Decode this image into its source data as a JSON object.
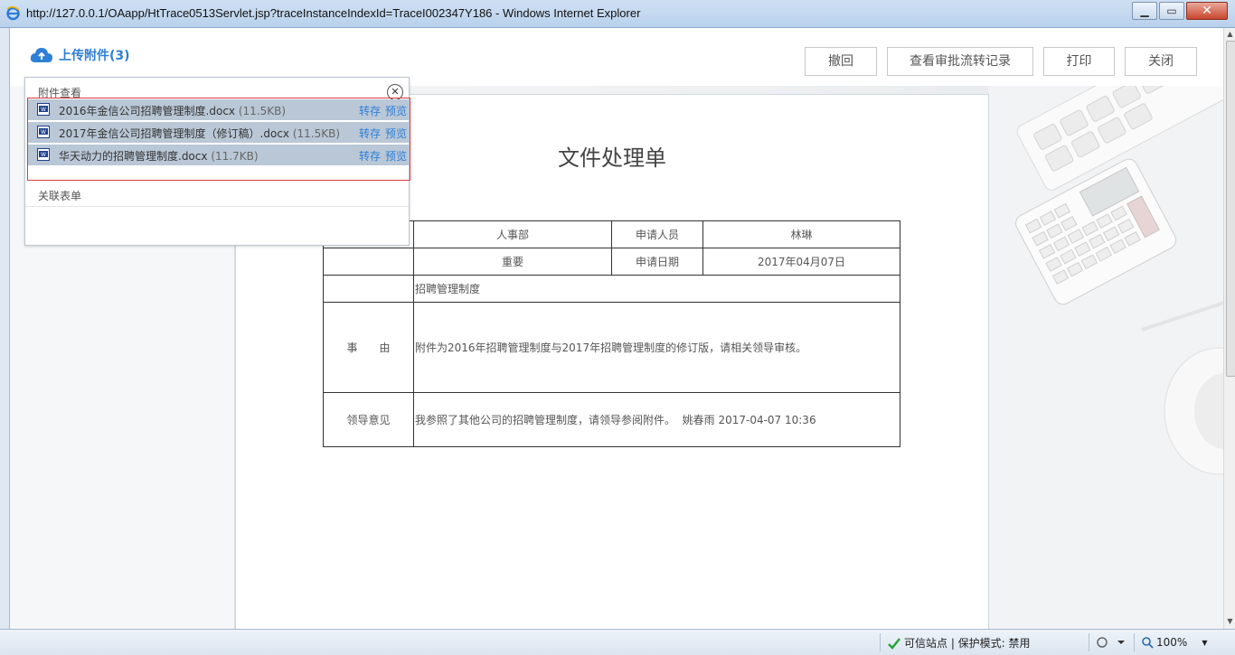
{
  "window": {
    "title": "http://127.0.0.1/OAapp/HtTrace0513Servlet.jsp?traceInstanceIndexId=TraceI002347Y186 - Windows Internet Explorer",
    "minimize_icon": "minimize-icon",
    "maximize_icon": "maximize-icon",
    "close_icon": "close-icon"
  },
  "toolbar": {
    "upload_label": "上传附件(3)",
    "buttons": [
      "撤回",
      "查看审批流转记录",
      "打印",
      "关闭"
    ]
  },
  "attachments_popup": {
    "header": "附件查看",
    "items": [
      {
        "name": "2016年金信公司招聘管理制度.docx",
        "size": "(11.5KB)",
        "save": "转存",
        "preview": "预览"
      },
      {
        "name": "2017年金信公司招聘管理制度（修订稿）.docx",
        "size": "(11.5KB)",
        "save": "转存",
        "preview": "预览"
      },
      {
        "name": "华天动力的招聘管理制度.docx",
        "size": "(11.7KB)",
        "save": "转存",
        "preview": "预览"
      }
    ],
    "related_forms": "关联表单"
  },
  "document": {
    "title": "文件处理单",
    "department": "人事部",
    "applicant_label": "申请人员",
    "applicant": "林琳",
    "priority": "重要",
    "date_label": "申请日期",
    "date": "2017年04月07日",
    "subject": "招聘管理制度",
    "reason_label": "事　　由",
    "reason": "附件为2016年招聘管理制度与2017年招聘管理制度的修订版，请相关领导审核。",
    "opinion_label": "领导意见",
    "opinion": "我参照了其他公司的招聘管理制度，请领导参阅附件。  姚春雨 2017-04-07 10:36"
  },
  "statusbar": {
    "trust": "可信站点 | 保护模式: 禁用",
    "zoom": "100%"
  },
  "colors": {
    "accent": "#2f7fd7",
    "highlight_border": "#e0393e",
    "row_selected": "#b9c7d6"
  }
}
